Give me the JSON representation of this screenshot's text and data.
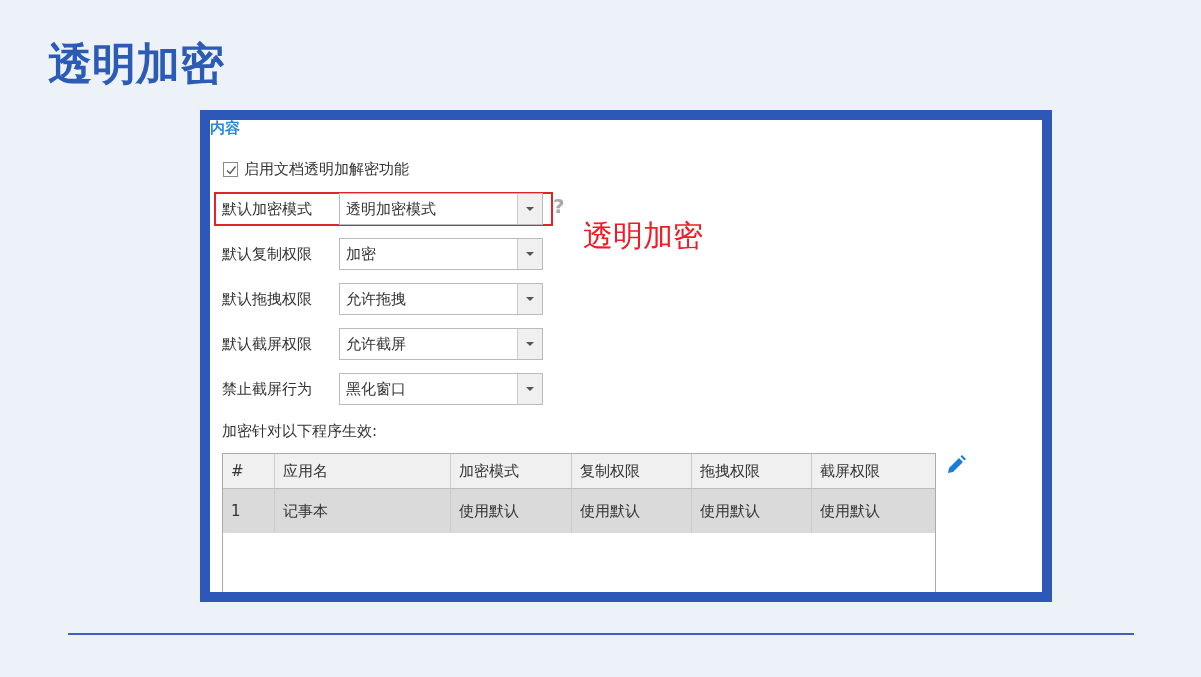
{
  "slide_title": "透明加密",
  "panel": {
    "section_heading": "内容",
    "checkbox": {
      "label": "启用文档透明加解密功能",
      "checked": true
    },
    "help_icon_text": "?",
    "fields": [
      {
        "label": "默认加密模式",
        "value": "透明加密模式",
        "highlighted": true
      },
      {
        "label": "默认复制权限",
        "value": "加密",
        "highlighted": false
      },
      {
        "label": "默认拖拽权限",
        "value": "允许拖拽",
        "highlighted": false
      },
      {
        "label": "默认截屏权限",
        "value": "允许截屏",
        "highlighted": false
      },
      {
        "label": "禁止截屏行为",
        "value": "黑化窗口",
        "highlighted": false
      }
    ],
    "annotation": "透明加密",
    "table_caption": "加密针对以下程序生效:",
    "table": {
      "columns": [
        "#",
        "应用名",
        "加密模式",
        "复制权限",
        "拖拽权限",
        "截屏权限"
      ],
      "rows": [
        {
          "cells": [
            "1",
            "记事本",
            "使用默认",
            "使用默认",
            "使用默认",
            "使用默认"
          ],
          "selected": true
        }
      ]
    }
  }
}
